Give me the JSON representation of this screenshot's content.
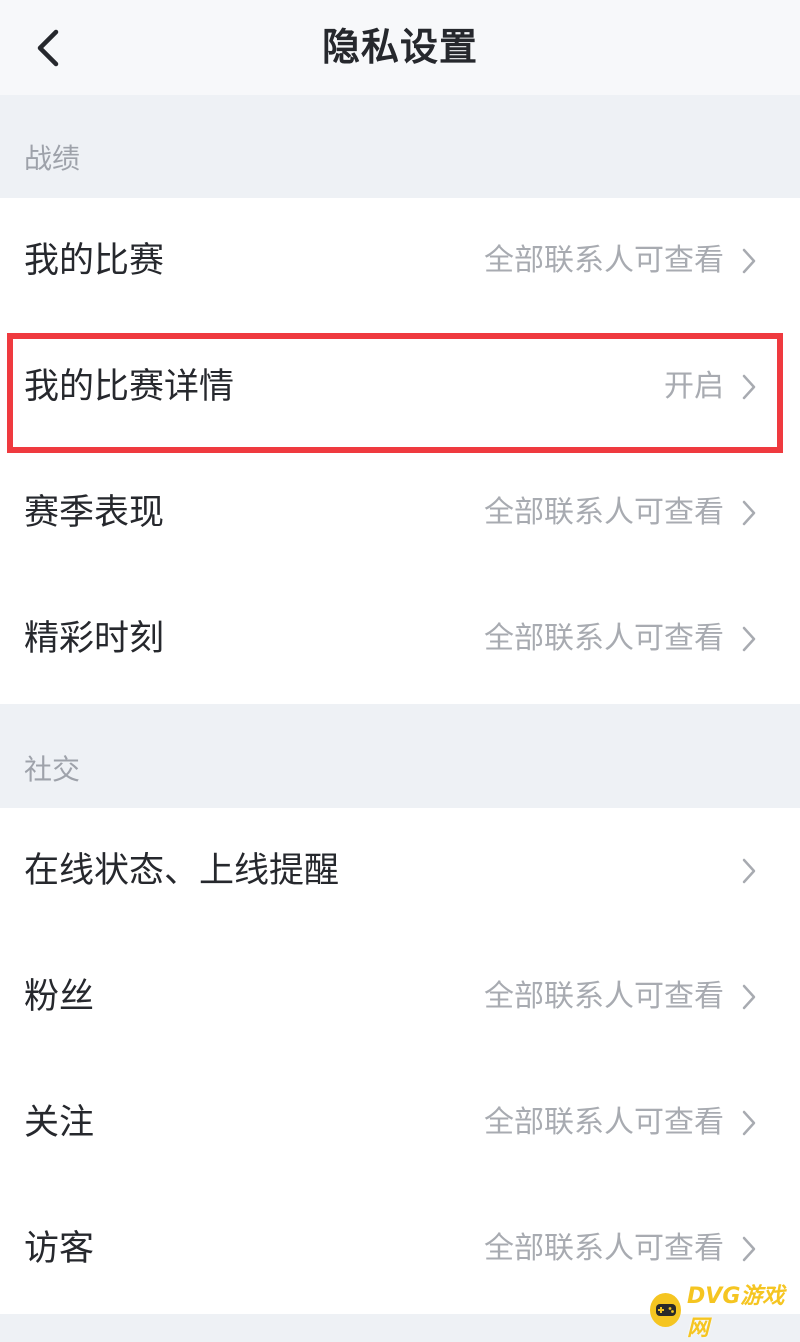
{
  "header": {
    "title": "隐私设置",
    "back_icon": "chevron-left-icon"
  },
  "sections": [
    {
      "label": "战绩",
      "rows": [
        {
          "label": "我的比赛",
          "value": "全部联系人可查看"
        },
        {
          "label": "我的比赛详情",
          "value": "开启"
        },
        {
          "label": "赛季表现",
          "value": "全部联系人可查看"
        },
        {
          "label": "精彩时刻",
          "value": "全部联系人可查看"
        }
      ]
    },
    {
      "label": "社交",
      "rows": [
        {
          "label": "在线状态、上线提醒",
          "value": ""
        },
        {
          "label": "粉丝",
          "value": "全部联系人可查看"
        },
        {
          "label": "关注",
          "value": "全部联系人可查看"
        },
        {
          "label": "访客",
          "value": "全部联系人可查看"
        }
      ]
    }
  ],
  "highlight_color": "#ef3a3f",
  "watermark": {
    "text": "DVG游戏网",
    "color": "#f5c521"
  }
}
